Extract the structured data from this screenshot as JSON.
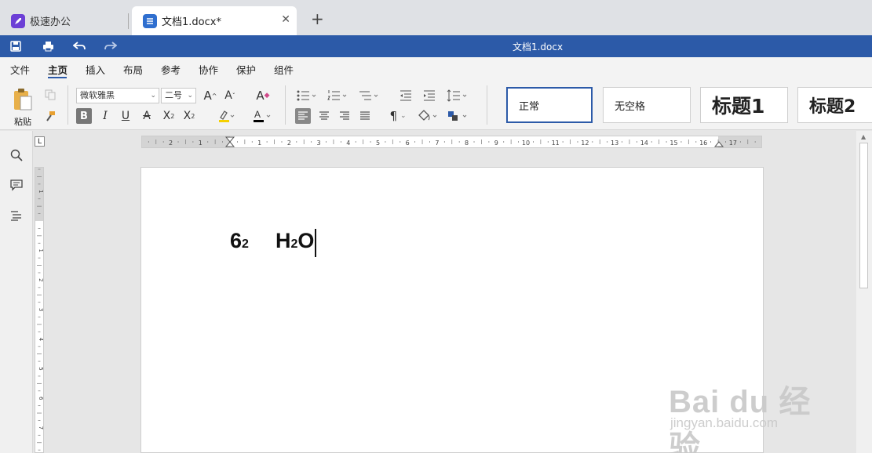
{
  "tabs": {
    "home": {
      "label": "极速办公",
      "icon": "rocket-icon"
    },
    "doc": {
      "label": "文档1.docx*",
      "icon": "document-icon"
    },
    "close": "✕",
    "new": "+"
  },
  "titlebar": {
    "title": "文档1.docx"
  },
  "menu": {
    "items": [
      {
        "label": "文件"
      },
      {
        "label": "主页"
      },
      {
        "label": "插入"
      },
      {
        "label": "布局"
      },
      {
        "label": "参考"
      },
      {
        "label": "协作"
      },
      {
        "label": "保护"
      },
      {
        "label": "组件"
      }
    ],
    "active": "主页"
  },
  "ribbon": {
    "paste_label": "粘贴",
    "font_name": "微软雅黑",
    "font_size": "二号",
    "styles": [
      {
        "label": "正常"
      },
      {
        "label": "无空格"
      },
      {
        "label": "标题1"
      },
      {
        "label": "标题2"
      }
    ]
  },
  "document": {
    "base1": "6",
    "sup1": "2",
    "base2": "H",
    "sub2": "2",
    "tail2": "O"
  },
  "ruler": {
    "marks": [
      "2",
      "1",
      "1",
      "2",
      "3",
      "4",
      "5",
      "6",
      "7",
      "8",
      "9",
      "10",
      "11",
      "12",
      "13",
      "14",
      "15",
      "16",
      "17"
    ],
    "vmarks": [
      "1",
      "1",
      "2",
      "3",
      "4",
      "5",
      "6",
      "7"
    ]
  },
  "watermark": {
    "logo": "Bai du 经验",
    "url": "jingyan.baidu.com"
  },
  "colors": {
    "accent": "#2c5aa8",
    "highlight": "#f5d000",
    "fontcolor": "#000000"
  }
}
